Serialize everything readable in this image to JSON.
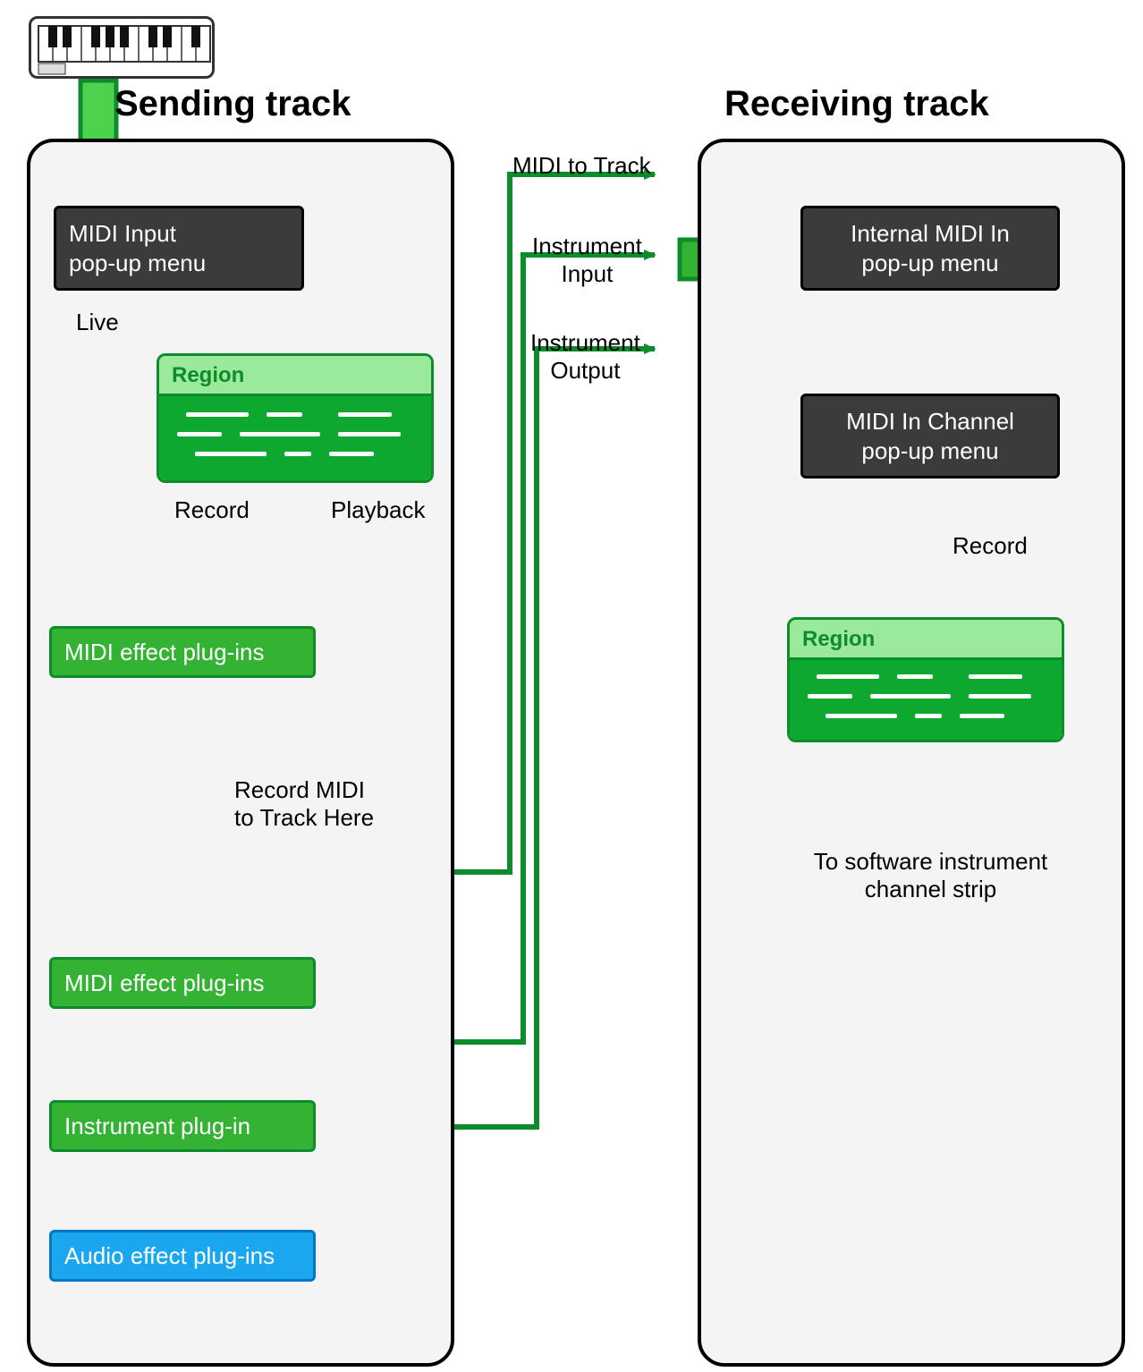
{
  "icons": {
    "keyboard": "keyboard-icon"
  },
  "titles": {
    "sending": "Sending track",
    "receiving": "Receiving track"
  },
  "sending": {
    "midi_input_title": "MIDI Input\npop-up menu",
    "live_label": "Live",
    "region_label": "Region",
    "record_label": "Record",
    "playback_label": "Playback",
    "midi_fx_1": "MIDI effect plug-ins",
    "record_here": "Record MIDI\nto Track Here",
    "midi_fx_2": "MIDI effect plug-ins",
    "instrument_plugin": "Instrument plug-in",
    "audio_fx": "Audio effect plug-ins"
  },
  "routing": {
    "midi_to_track": "MIDI to Track",
    "instrument_input": "Instrument\nInput",
    "instrument_output": "Instrument\nOutput"
  },
  "receiving": {
    "internal_midi_in_title": "Internal MIDI In\npop-up menu",
    "midi_in_channel_title": "MIDI In Channel\npop-up menu",
    "record_label": "Record",
    "region_label": "Region",
    "to_channel_strip": "To software instrument\nchannel strip"
  },
  "colors": {
    "green_light": "#4cd24c",
    "green_dark": "#0d8c2b",
    "blue": "#1ba7ef",
    "orange": "#f8a11a"
  }
}
